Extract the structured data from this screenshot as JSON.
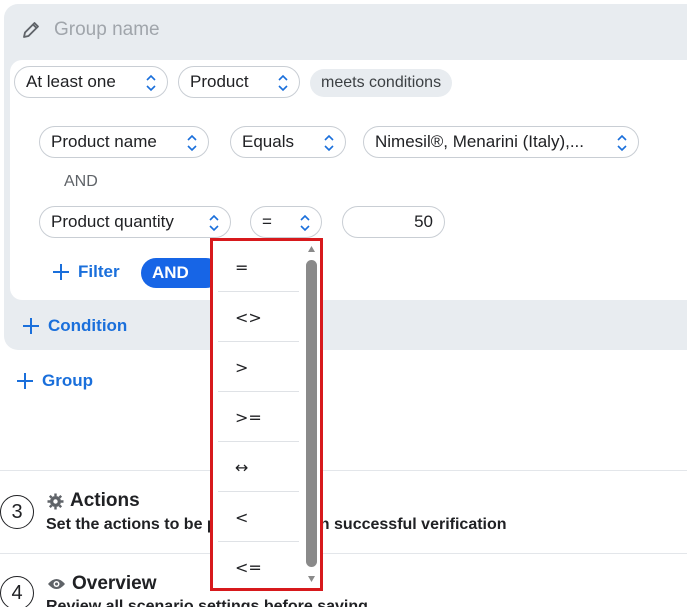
{
  "group": {
    "name_placeholder": "Group name",
    "quantifier": "At least one",
    "entity": "Product",
    "meets_label": "meets conditions"
  },
  "conditions": {
    "row1": {
      "field": "Product name",
      "operator": "Equals",
      "value": "Nimesil®, Menarini (Italy),..."
    },
    "joiner": "AND",
    "row2": {
      "field": "Product quantity",
      "operator": "=",
      "value": "50"
    }
  },
  "buttons": {
    "filter": "Filter",
    "logic": "AND",
    "condition": "Condition",
    "group": "Group"
  },
  "steps": [
    {
      "number": "3",
      "title": "Actions",
      "description": "Set the actions to be performed upon successful verification",
      "icon": "gear-icon"
    },
    {
      "number": "4",
      "title": "Overview",
      "description": "Review all scenario settings before saving",
      "icon": "eye-icon"
    }
  ],
  "operator_dropdown": {
    "options": [
      "=",
      "<>",
      ">",
      ">=",
      "↔",
      "<",
      "<="
    ],
    "highlight_color": "#d7191c"
  },
  "colors": {
    "accent": "#1a6fdb",
    "and_pill": "#1765e6",
    "panel_bg": "#e8ecf0"
  }
}
